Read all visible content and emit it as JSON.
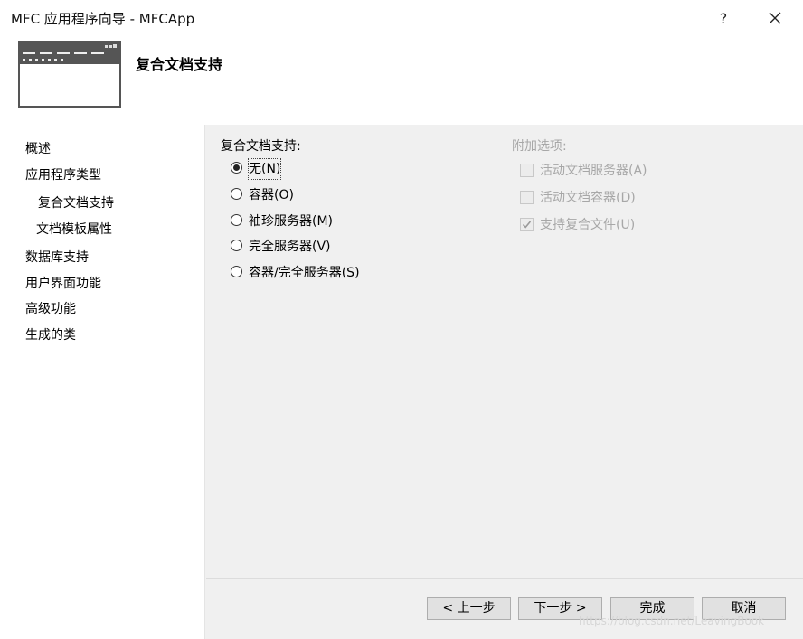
{
  "window": {
    "title": "MFC 应用程序向导 - MFCApp",
    "help_label": "?"
  },
  "header": {
    "title": "复合文档支持"
  },
  "sidebar": {
    "items": [
      {
        "label": "概述"
      },
      {
        "label": "应用程序类型"
      },
      {
        "label": "复合文档支持"
      },
      {
        "label": "文档模板属性"
      },
      {
        "label": "数据库支持"
      },
      {
        "label": "用户界面功能"
      },
      {
        "label": "高级功能"
      },
      {
        "label": "生成的类"
      }
    ]
  },
  "compound": {
    "label": "复合文档支持:",
    "options": [
      {
        "label": "无(N)",
        "selected": true
      },
      {
        "label": "容器(O)",
        "selected": false
      },
      {
        "label": "袖珍服务器(M)",
        "selected": false
      },
      {
        "label": "完全服务器(V)",
        "selected": false
      },
      {
        "label": "容器/完全服务器(S)",
        "selected": false
      }
    ]
  },
  "extra": {
    "label": "附加选项:",
    "options": [
      {
        "label": "活动文档服务器(A)",
        "checked": false
      },
      {
        "label": "活动文档容器(D)",
        "checked": false
      },
      {
        "label": "支持复合文件(U)",
        "checked": true
      }
    ]
  },
  "buttons": {
    "back": "< 上一步",
    "next": "下一步 >",
    "finish": "完成",
    "cancel": "取消"
  },
  "watermark": "https://blog.csdn.net/LeavingBook",
  "icons": {
    "close": "close-icon",
    "header": "window-icon"
  },
  "colors": {
    "panel_bg": "#f0f0f0",
    "disabled_text": "#a7a7a7",
    "button_bg": "#e1e1e1"
  }
}
